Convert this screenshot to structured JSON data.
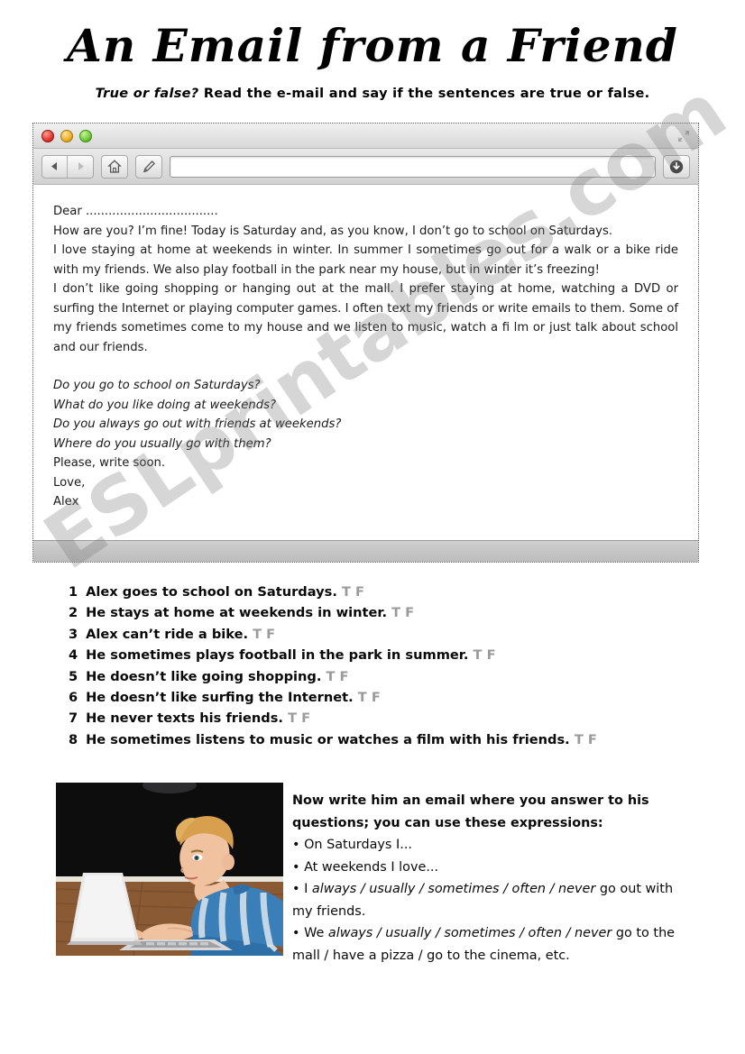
{
  "title": "An Email from a Friend",
  "subtitle": {
    "lead": "True or false?",
    "rest": " Read the e-mail and say if the sentences are true or false."
  },
  "browser": {
    "lights": [
      "close-red",
      "minimize-yellow",
      "zoom-green"
    ],
    "back_icon": "back-arrow-icon",
    "forward_icon": "forward-arrow-icon",
    "home_icon": "home-icon",
    "pen_icon": "pen-icon",
    "download_icon": "download-icon",
    "resize_icon": "resize-icon",
    "url_value": "",
    "url_placeholder": ""
  },
  "email": {
    "greeting": "Dear ...................................",
    "para1_line1": "How are you? I’m fine! Today is Saturday and, as you know, I don’t go to school on Saturdays.",
    "para1_line2": "I love staying at home at weekends in winter. In summer I sometimes go out for a walk or a bike ride with my friends. We also play football in the park near my house, but in winter it’s freezing!",
    "para2": "I don’t like going shopping or hanging out at the mall. I prefer staying at home, watching a DVD or surfing the Internet or playing computer games. I often text my friends or write emails to them. Some of my friends sometimes come to my house and we listen to music, watch a fi lm or just talk about school and our friends.",
    "questions": [
      "Do you go to school on Saturdays?",
      "What do you like doing at weekends?",
      "Do you always go out with friends at weekends?",
      "Where do you usually go with them?"
    ],
    "closing1": "Please, write soon.",
    "closing2": "Love,",
    "signature": "Alex"
  },
  "true_false": {
    "tf_label": "T F",
    "items": [
      {
        "num": "1",
        "text": "Alex goes to school on Saturdays."
      },
      {
        "num": "2",
        "text": "He stays at home at weekends in winter."
      },
      {
        "num": "3",
        "text": "Alex can’t ride a bike."
      },
      {
        "num": "4",
        "text": "He sometimes plays football in the park in summer."
      },
      {
        "num": "5",
        "text": "He doesn’t like going shopping."
      },
      {
        "num": "6",
        "text": "He doesn’t like surfing the Internet."
      },
      {
        "num": "7",
        "text": "He never texts his friends."
      },
      {
        "num": "8",
        "text": "He sometimes listens to music or watches a film with his friends."
      }
    ]
  },
  "photo": {
    "alt": "teenage-boy-lying-on-floor-using-laptop"
  },
  "task": {
    "heading_line1": "Now write him an email where you answer to his",
    "heading_line2": "questions; you can use these expressions:",
    "bullet1": "• On Saturdays I...",
    "bullet2": "• At weekends I love...",
    "bullet3_pre": "• I ",
    "bullet3_it": "always / usually / sometimes / often / never",
    "bullet3_post": " go out with my friends.",
    "bullet4_pre": "• We ",
    "bullet4_it": "always / usually / sometimes / often / never",
    "bullet4_post": " go to the mall / have a pizza / go to the cinema, etc."
  },
  "watermark": {
    "text": "ESLprintables.com"
  }
}
